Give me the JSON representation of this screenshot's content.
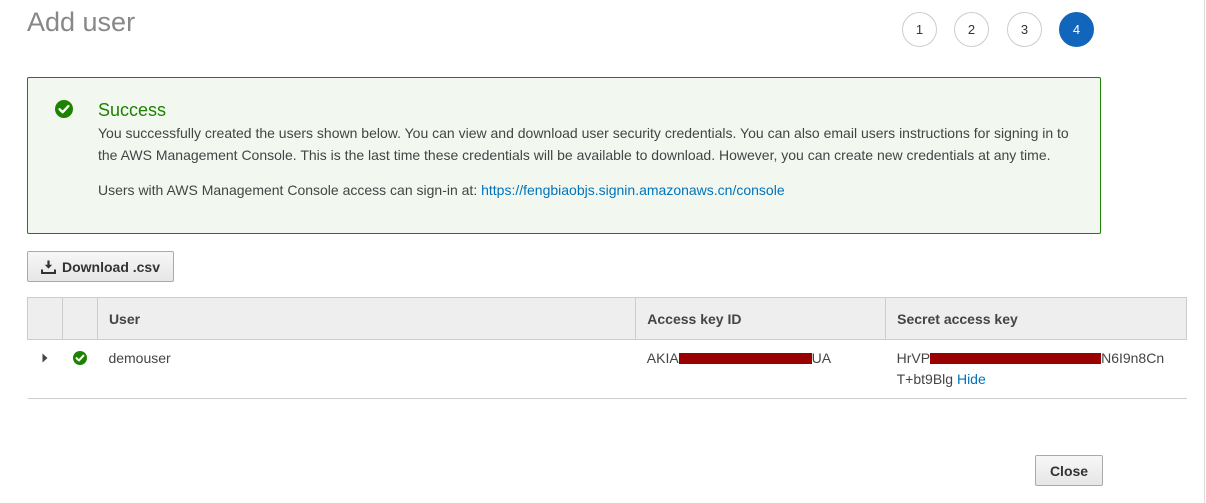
{
  "page": {
    "title": "Add user"
  },
  "steps": [
    "1",
    "2",
    "3",
    "4"
  ],
  "active_step": 4,
  "alert": {
    "title": "Success",
    "message": "You successfully created the users shown below. You can view and download user security credentials. You can also email users instructions for signing in to the AWS Management Console. This is the last time these credentials will be available to download. However, you can create new credentials at any time.",
    "signin_prefix": "Users with AWS Management Console access can sign-in at:",
    "signin_url": "https://fengbiaobjs.signin.amazonaws.cn/console",
    "icon": "check-circle-icon",
    "color": "#1d8102"
  },
  "download_button": {
    "label": "Download .csv",
    "icon": "download-icon"
  },
  "table": {
    "columns": [
      "User",
      "Access key ID",
      "Secret access key"
    ],
    "rows": [
      {
        "user": "demouser",
        "status_icon": "check-circle-icon",
        "access_key_prefix": "AKIA",
        "access_key_suffix": "UA",
        "secret_prefix": "HrVP",
        "secret_suffix": "N6I9n8Cn",
        "secret_line2": "T+bt9Blg",
        "hide_label": "Hide"
      }
    ]
  },
  "close_button": {
    "label": "Close"
  },
  "colors": {
    "accent": "#1166bb",
    "link": "#0073bb",
    "success": "#1d8102",
    "redaction": "#990000"
  }
}
